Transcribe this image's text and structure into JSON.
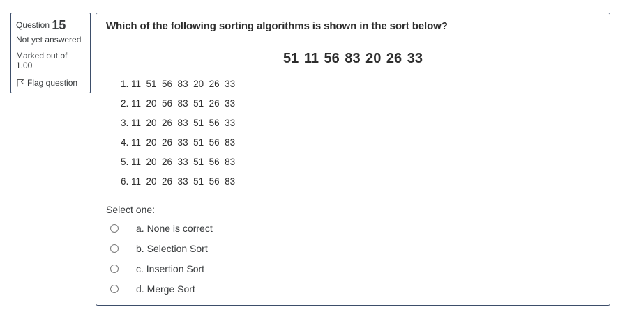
{
  "info": {
    "question_label": "Question",
    "question_number": "15",
    "state": "Not yet answered",
    "grade_line1": "Marked out of",
    "grade_line2": "1.00",
    "flag_label": "Flag question"
  },
  "question": {
    "text": "Which of the following sorting algorithms is shown in the sort below?",
    "sequence": "51  11  56  83  20  26  33",
    "steps": [
      "1. 11  51  56  83  20  26  33",
      "2. 11  20  56  83  51  26  33",
      "3. 11  20  26  83  51  56  33",
      "4. 11  20  26  33  51  56  83",
      "5. 11  20  26  33  51  56  83",
      "6. 11  20  26  33  51  56  83"
    ]
  },
  "answer": {
    "prompt": "Select one:",
    "options": [
      "a. None is correct",
      "b. Selection Sort",
      "c. Insertion Sort",
      "d. Merge Sort"
    ]
  }
}
